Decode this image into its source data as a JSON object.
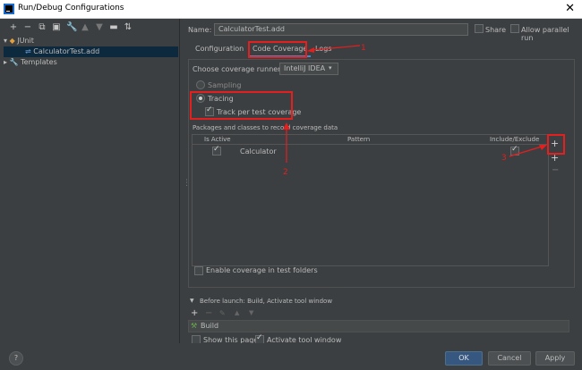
{
  "window": {
    "title": "Run/Debug Configurations",
    "close_glyph": "✕"
  },
  "left_toolbar": {
    "icons": [
      "add-icon",
      "remove-icon",
      "copy-icon",
      "save-icon",
      "wrench-icon",
      "arrow-up-icon",
      "arrow-down-icon",
      "folder-icon",
      "sort-icon"
    ]
  },
  "tree": {
    "junit": "JUnit",
    "child": "CalculatorTest.add",
    "templates": "Templates"
  },
  "name_row": {
    "label": "Name:",
    "value": "CalculatorTest.add",
    "share": "Share",
    "allow_parallel": "Allow parallel run"
  },
  "tabs": {
    "configuration": "Configuration",
    "code_coverage": "Code Coverage",
    "logs": "Logs"
  },
  "coverage": {
    "runner_label": "Choose coverage runner:",
    "runner_value": "IntelliJ IDEA",
    "sampling": "Sampling",
    "tracing": "Tracing",
    "track_per_test": "Track per test coverage",
    "packages_label": "Packages and classes to record coverage data",
    "columns": {
      "is_active": "Is Active",
      "pattern": "Pattern",
      "include_exclude": "Include/Exclude"
    },
    "row": {
      "pattern": "Calculator"
    },
    "enable_in_test_folders": "Enable coverage in test folders"
  },
  "annotations": {
    "n1": "1",
    "n2": "2",
    "n3": "3",
    "color": "#e51e1e"
  },
  "before_launch": {
    "header": "Before launch: Build, Activate tool window",
    "item": "Build",
    "show_page": "Show this page",
    "activate_tool_window": "Activate tool window"
  },
  "footer": {
    "help": "?",
    "ok": "OK",
    "cancel": "Cancel",
    "apply": "Apply"
  }
}
